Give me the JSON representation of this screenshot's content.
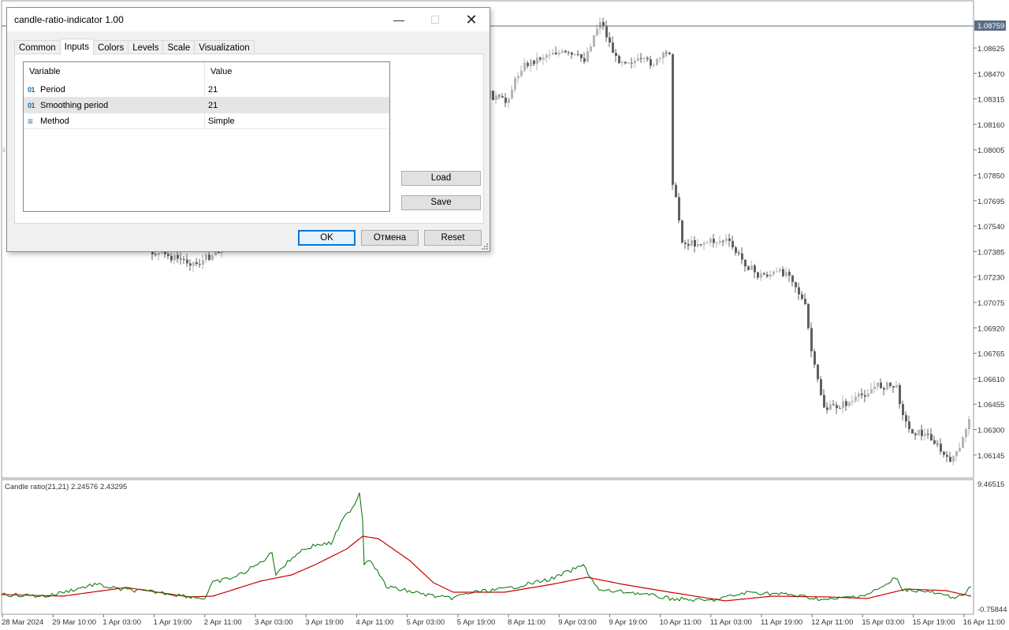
{
  "dialog": {
    "title": "candle-ratio-indicator 1.00",
    "tabs": [
      "Common",
      "Inputs",
      "Colors",
      "Levels",
      "Scale",
      "Visualization"
    ],
    "active_tab": "Inputs",
    "grid": {
      "headers": {
        "variable": "Variable",
        "value": "Value"
      },
      "rows": [
        {
          "icon": "int-param-icon",
          "icon_glyph": "01",
          "variable": "Period",
          "value": "21"
        },
        {
          "icon": "int-param-icon",
          "icon_glyph": "01",
          "variable": "Smoothing period",
          "value": "21"
        },
        {
          "icon": "enum-param-icon",
          "icon_glyph": "≡",
          "variable": "Method",
          "value": "Simple"
        }
      ],
      "selected_row": 1
    },
    "buttons": {
      "load": "Load",
      "save": "Save",
      "ok": "OK",
      "cancel": "Отмена",
      "reset": "Reset"
    }
  },
  "price_axis": {
    "labels": [
      "1.08625",
      "1.08470",
      "1.08315",
      "1.08160",
      "1.08005",
      "1.07850",
      "1.07695",
      "1.07540",
      "1.07385",
      "1.07230",
      "1.07075",
      "1.06920",
      "1.06765",
      "1.06610",
      "1.06455",
      "1.06300",
      "1.06145"
    ],
    "current_price": "1.08759"
  },
  "indicator": {
    "label": "Candle ratio(21,21) 2.24576 2.43295",
    "axis_top": "9.46515",
    "axis_bottom": "-0.75844"
  },
  "time_axis": {
    "labels": [
      "28 Mar 2024",
      "29 Mar 10:00",
      "1 Apr 03:00",
      "1 Apr 19:00",
      "2 Apr 11:00",
      "3 Apr 03:00",
      "3 Apr 19:00",
      "4 Apr 11:00",
      "5 Apr 03:00",
      "5 Apr 19:00",
      "8 Apr 11:00",
      "9 Apr 03:00",
      "9 Apr 19:00",
      "10 Apr 11:00",
      "11 Apr 03:00",
      "11 Apr 19:00",
      "12 Apr 11:00",
      "15 Apr 03:00",
      "15 Apr 19:00",
      "16 Apr 11:00"
    ]
  },
  "colors": {
    "bull_candle": "#b5b5b5",
    "bear_candle": "#606060",
    "ratio_line": "#007000",
    "signal_line": "#cc0000",
    "price_line": "#5a6e86",
    "default_button_border": "#0078d7"
  }
}
